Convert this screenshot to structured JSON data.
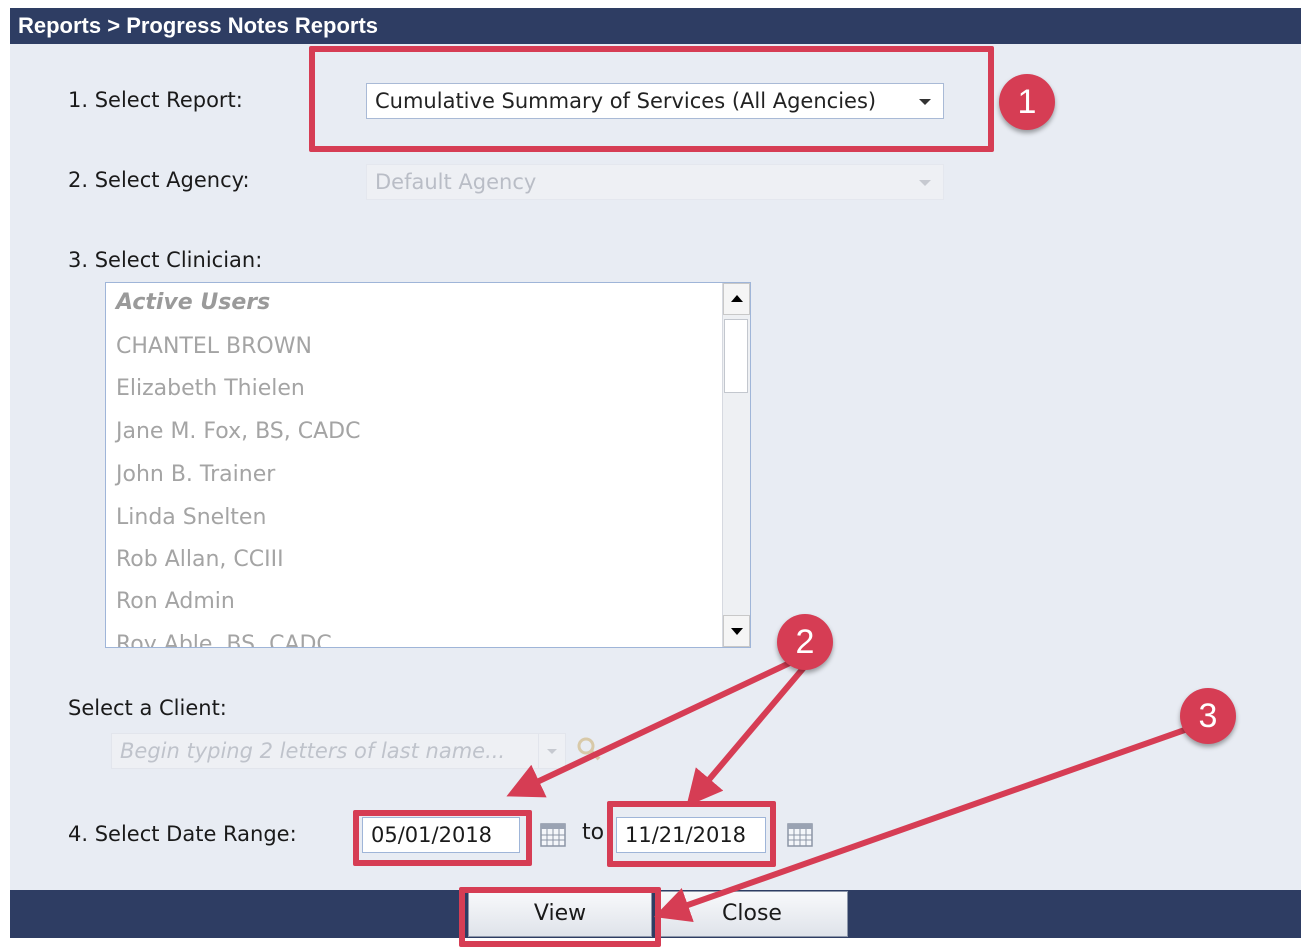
{
  "window": {
    "title": "Reports > Progress Notes Reports"
  },
  "report": {
    "label": "1. Select Report:",
    "value": "Cumulative Summary of Services (All Agencies)"
  },
  "agency": {
    "label": "2. Select Agency:",
    "value": "Default Agency"
  },
  "clinician": {
    "label": "3. Select Clinician:",
    "items": [
      "Active Users",
      "CHANTEL BROWN",
      "Elizabeth Thielen",
      "Jane M. Fox, BS, CADC",
      "John B. Trainer",
      "Linda Snelten",
      "Rob Allan, CCIII",
      "Ron Admin",
      "Roy Able, BS, CADC"
    ]
  },
  "client": {
    "label": "Select a Client:",
    "placeholder": "Begin typing 2 letters of last name..."
  },
  "date_range": {
    "label": "4. Select Date Range:",
    "from": "05/01/2018",
    "to_label": "to",
    "to": "11/21/2018"
  },
  "buttons": {
    "view": "View",
    "close": "Close"
  },
  "annotations": {
    "badge1": "1",
    "badge2": "2",
    "badge3": "3",
    "color": "#d63d54"
  },
  "icons": [
    "dropdown-caret-icon",
    "scroll-up-icon",
    "scroll-down-icon",
    "search-icon",
    "calendar-icon"
  ]
}
